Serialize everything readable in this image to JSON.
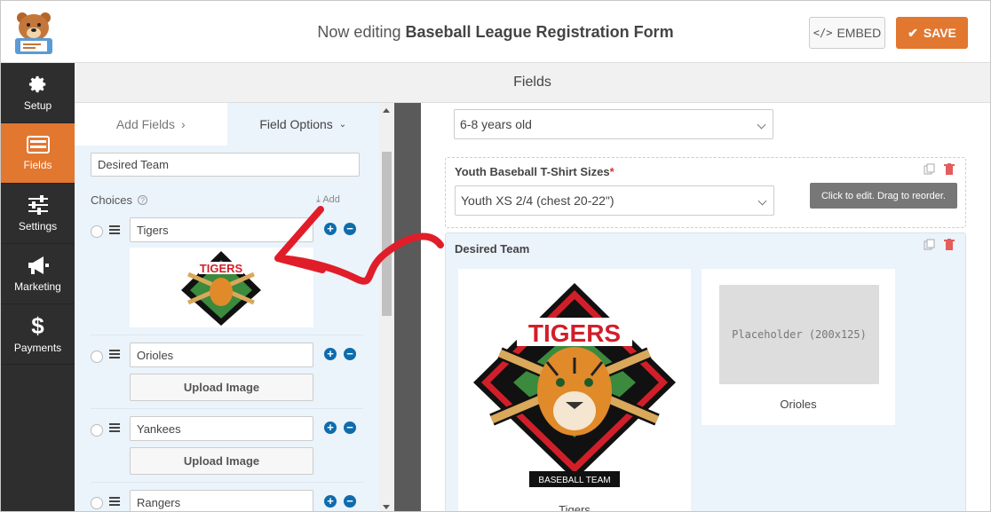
{
  "header": {
    "title_prefix": "Now editing",
    "form_name": "Baseball League Registration Form",
    "embed_label": "EMBED",
    "embed_icon": "code-icon",
    "save_label": "SAVE",
    "save_icon": "check-icon",
    "brand_color": "#e27730"
  },
  "sidebar": {
    "items": [
      {
        "label": "Setup",
        "icon": "gear-icon"
      },
      {
        "label": "Fields",
        "icon": "form-fields-icon",
        "active": true
      },
      {
        "label": "Settings",
        "icon": "sliders-icon"
      },
      {
        "label": "Marketing",
        "icon": "megaphone-icon"
      },
      {
        "label": "Payments",
        "icon": "dollar-icon"
      }
    ]
  },
  "section_title": "Fields",
  "panel": {
    "tabs": [
      {
        "label": "Add Fields"
      },
      {
        "label": "Field Options"
      }
    ],
    "field_label_value": "Desired Team",
    "choices_label": "Choices",
    "bulk_add_label": "Add",
    "choices": [
      {
        "value": "Tigers",
        "has_image": true
      },
      {
        "value": "Orioles",
        "upload_label": "Upload Image"
      },
      {
        "value": "Yankees",
        "upload_label": "Upload Image"
      },
      {
        "value": "Rangers"
      }
    ]
  },
  "preview": {
    "age_select_value": "6-8 years old",
    "shirt_field": {
      "label": "Youth Baseball T-Shirt Sizes",
      "required_mark": "*",
      "value": "Youth XS  2/4 (chest 20-22\")"
    },
    "tooltip": "Click to edit. Drag to reorder.",
    "team_field": {
      "label": "Desired Team",
      "choices": [
        {
          "label": "Tigers",
          "logo_text": "TIGERS",
          "banner_text": "BASEBALL TEAM"
        },
        {
          "label": "Orioles",
          "placeholder": "Placeholder (200x125)"
        }
      ]
    }
  }
}
